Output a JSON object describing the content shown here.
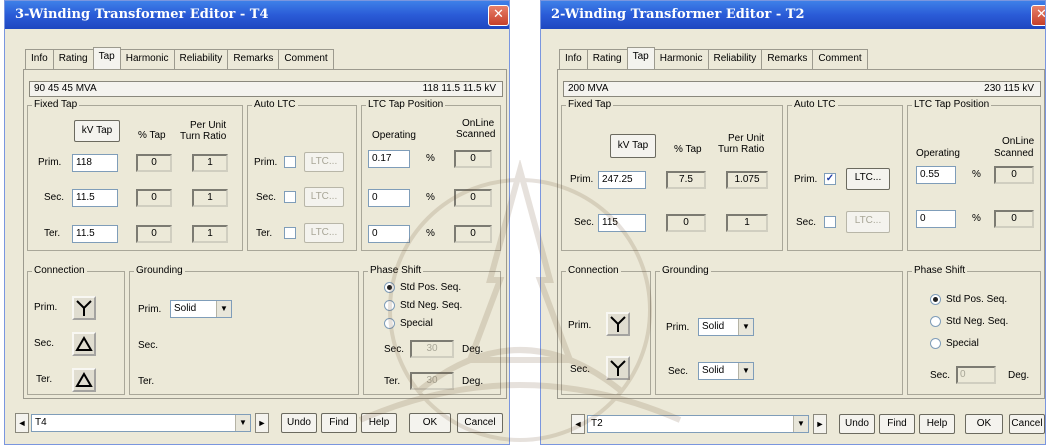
{
  "left": {
    "title": "3-Winding Transformer Editor - T4",
    "tabs": [
      "Info",
      "Rating",
      "Tap",
      "Harmonic",
      "Reliability",
      "Remarks",
      "Comment"
    ],
    "active_tab": "Tap",
    "info": {
      "rating": "90  45  45 MVA",
      "kv": "118  11.5  11.5 kV"
    },
    "fixed_tap": {
      "title": "Fixed Tap",
      "kv_tap_button": "kV Tap",
      "col_pct_tap": "% Tap",
      "col_ratio_1": "Per Unit",
      "col_ratio_2": "Turn Ratio",
      "rows": [
        {
          "label": "Prim.",
          "kv": "118",
          "pct": "0",
          "ratio": "1"
        },
        {
          "label": "Sec.",
          "kv": "11.5",
          "pct": "0",
          "ratio": "1"
        },
        {
          "label": "Ter.",
          "kv": "11.5",
          "pct": "0",
          "ratio": "1"
        }
      ]
    },
    "auto_ltc": {
      "title": "Auto LTC",
      "rows": [
        {
          "label": "Prim.",
          "button": "LTC...",
          "checked": false
        },
        {
          "label": "Sec.",
          "button": "LTC...",
          "checked": false
        },
        {
          "label": "Ter.",
          "button": "LTC...",
          "checked": false
        }
      ]
    },
    "ltc_position": {
      "title": "LTC Tap Position",
      "col_operating": "Operating",
      "col_online_1": "OnLine",
      "col_online_2": "Scanned",
      "unit": "%",
      "rows": [
        {
          "operating": "0.17",
          "scanned": "0"
        },
        {
          "operating": "0",
          "scanned": "0"
        },
        {
          "operating": "0",
          "scanned": "0"
        }
      ]
    },
    "connection": {
      "title": "Connection",
      "rows": [
        {
          "label": "Prim.",
          "symbol": "wye"
        },
        {
          "label": "Sec.",
          "symbol": "delta"
        },
        {
          "label": "Ter.",
          "symbol": "delta"
        }
      ]
    },
    "grounding": {
      "title": "Grounding",
      "prim_label": "Prim.",
      "prim_value": "Solid",
      "sec_label": "Sec.",
      "ter_label": "Ter."
    },
    "phase_shift": {
      "title": "Phase Shift",
      "options": [
        "Std Pos. Seq.",
        "Std Neg. Seq.",
        "Special"
      ],
      "selected": 0,
      "sec_label": "Sec.",
      "sec_value": "30",
      "ter_label": "Ter.",
      "ter_value": "30",
      "unit": "Deg."
    },
    "bottom": {
      "record": "T4",
      "undo": "Undo",
      "find": "Find",
      "help": "Help",
      "ok": "OK",
      "cancel": "Cancel"
    }
  },
  "right": {
    "title": "2-Winding Transformer Editor - T2",
    "tabs": [
      "Info",
      "Rating",
      "Tap",
      "Harmonic",
      "Reliability",
      "Remarks",
      "Comment"
    ],
    "active_tab": "Tap",
    "info": {
      "rating": "200 MVA",
      "kv": "230   115 kV"
    },
    "fixed_tap": {
      "title": "Fixed Tap",
      "kv_tap_button": "kV Tap",
      "col_pct_tap": "% Tap",
      "col_ratio_1": "Per Unit",
      "col_ratio_2": "Turn Ratio",
      "rows": [
        {
          "label": "Prim.",
          "kv": "247.25",
          "pct": "7.5",
          "ratio": "1.075"
        },
        {
          "label": "Sec.",
          "kv": "115",
          "pct": "0",
          "ratio": "1"
        }
      ]
    },
    "auto_ltc": {
      "title": "Auto LTC",
      "rows": [
        {
          "label": "Prim.",
          "button": "LTC...",
          "checked": true
        },
        {
          "label": "Sec.",
          "button": "LTC...",
          "checked": false
        }
      ]
    },
    "ltc_position": {
      "title": "LTC Tap Position",
      "col_operating": "Operating",
      "col_online_1": "OnLine",
      "col_online_2": "Scanned",
      "unit": "%",
      "rows": [
        {
          "operating": "0.55",
          "scanned": "0"
        },
        {
          "operating": "0",
          "scanned": "0"
        }
      ]
    },
    "connection": {
      "title": "Connection",
      "rows": [
        {
          "label": "Prim.",
          "symbol": "wye"
        },
        {
          "label": "Sec.",
          "symbol": "wye"
        }
      ]
    },
    "grounding": {
      "title": "Grounding",
      "prim_label": "Prim.",
      "prim_value": "Solid",
      "sec_label": "Sec.",
      "sec_value": "Solid"
    },
    "phase_shift": {
      "title": "Phase Shift",
      "options": [
        "Std Pos. Seq.",
        "Std Neg. Seq.",
        "Special"
      ],
      "selected": 0,
      "sec_label": "Sec.",
      "sec_value": "0",
      "unit": "Deg."
    },
    "bottom": {
      "record": "T2",
      "undo": "Undo",
      "find": "Find",
      "help": "Help",
      "ok": "OK",
      "cancel": "Cancel"
    }
  },
  "colors": {
    "titlebar": "#2a5bd7",
    "dialog_bg": "#ece9d8",
    "close": "#c6402a"
  }
}
